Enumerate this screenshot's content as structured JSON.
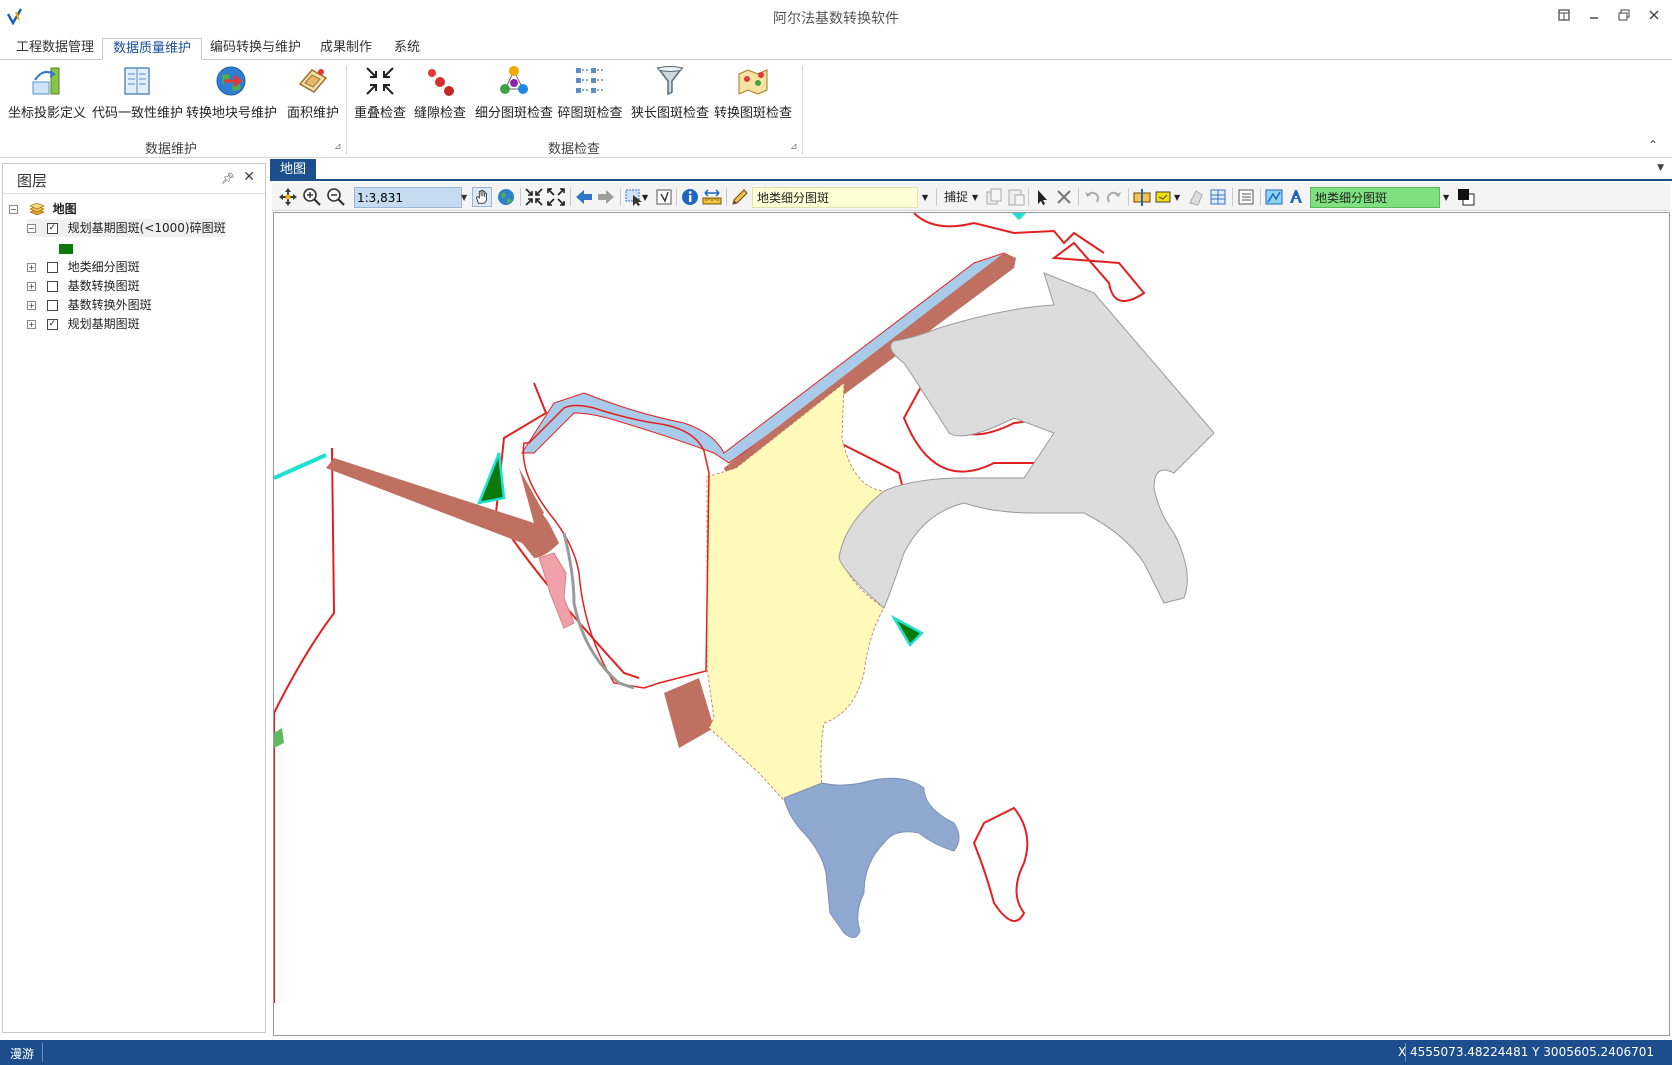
{
  "window": {
    "title": "阿尔法基数转换软件",
    "controls": [
      "restore-tile-icon",
      "minimize-icon",
      "maximize-icon",
      "close-icon"
    ]
  },
  "ribbon": {
    "tabs": [
      {
        "label": "工程数据管理",
        "active": false
      },
      {
        "label": "数据质量维护",
        "active": true
      },
      {
        "label": "编码转换与维护",
        "active": false
      },
      {
        "label": "成果制作",
        "active": false
      },
      {
        "label": "系统",
        "active": false
      }
    ],
    "groups": [
      {
        "label": "数据维护",
        "buttons": [
          {
            "label": "坐标投影定义",
            "icon": "projection-icon"
          },
          {
            "label": "代码一致性维护",
            "icon": "code-consistency-icon"
          },
          {
            "label": "转换地块号维护",
            "icon": "parcel-number-icon"
          },
          {
            "label": "面积维护",
            "icon": "area-icon"
          }
        ]
      },
      {
        "label": "数据检查",
        "buttons": [
          {
            "label": "重叠检查",
            "icon": "overlap-check-icon"
          },
          {
            "label": "缝隙检查",
            "icon": "gap-check-icon"
          },
          {
            "label": "细分图斑检查",
            "icon": "subdivision-check-icon"
          },
          {
            "label": "碎图斑检查",
            "icon": "fragment-check-icon"
          },
          {
            "label": "狭长图斑检查",
            "icon": "narrow-check-icon"
          },
          {
            "label": "转换图斑检查",
            "icon": "conversion-check-icon"
          }
        ]
      }
    ]
  },
  "layers": {
    "title": "图层",
    "root": "地图",
    "items": [
      {
        "label": "规划基期图斑(<1000)碎图斑",
        "checked": true,
        "expanded": true,
        "legend_color": "#0b7a0b"
      },
      {
        "label": "地类细分图斑",
        "checked": false,
        "expanded": false
      },
      {
        "label": "基数转换图斑",
        "checked": false,
        "expanded": false
      },
      {
        "label": "基数转换外图斑",
        "checked": false,
        "expanded": false
      },
      {
        "label": "规划基期图斑",
        "checked": true,
        "expanded": false
      }
    ]
  },
  "map": {
    "tab": "地图",
    "scale": "1:3,831",
    "edit_layer": "地类细分图斑",
    "snap_label": "捕捉",
    "target_layer": "地类细分图斑",
    "target_color": "#7fe07f",
    "edit_combo_color": "#ffffd6"
  },
  "status": {
    "mode": "漫游",
    "coordinates": "X 4555073.48224481  Y 3005605.2406701"
  }
}
